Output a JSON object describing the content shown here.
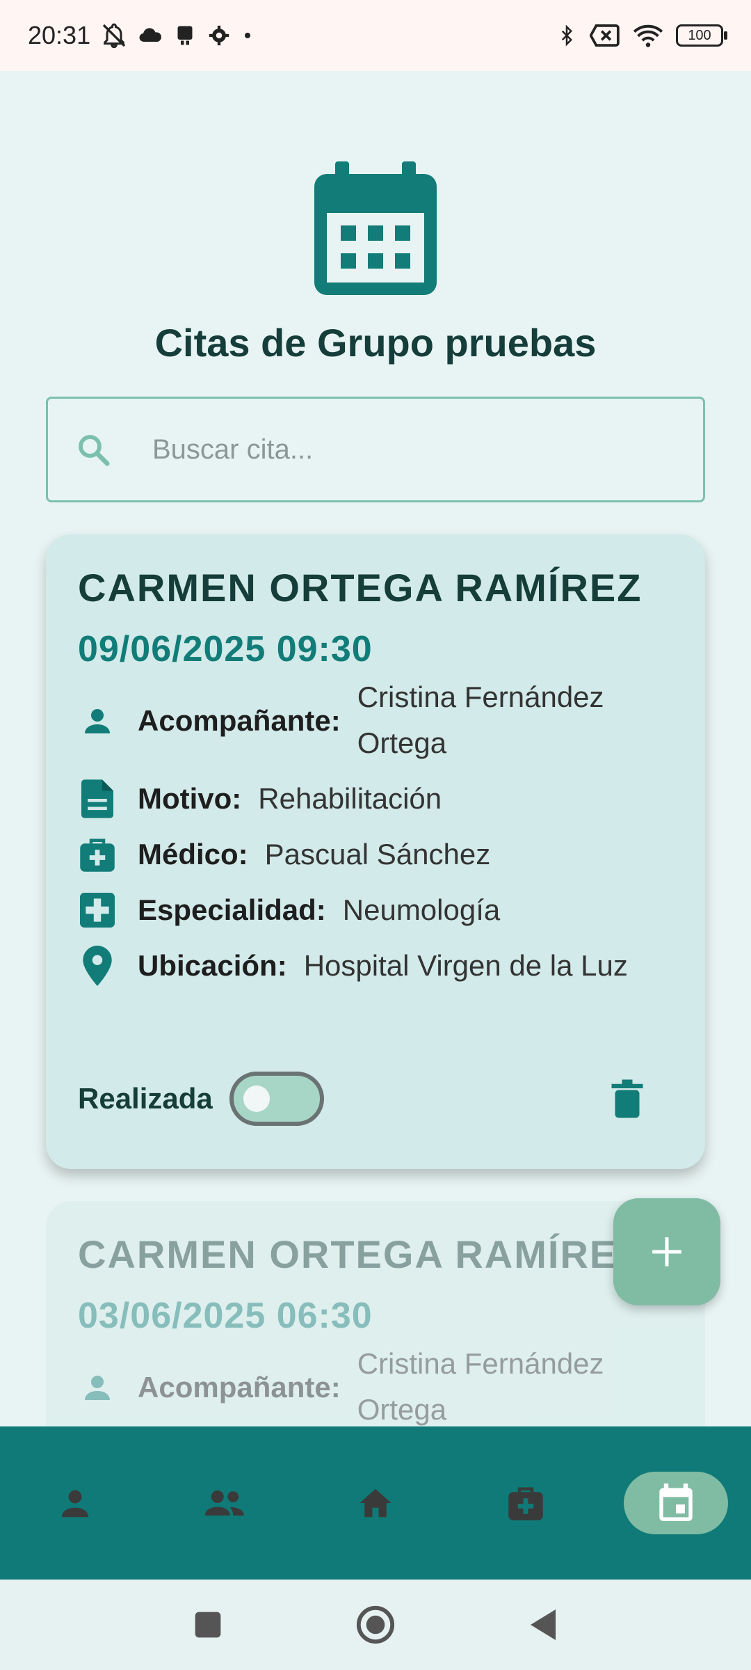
{
  "status_bar": {
    "time": "20:31",
    "battery": "100"
  },
  "page_title": "Citas de Grupo pruebas",
  "search": {
    "placeholder": "Buscar cita...",
    "value": ""
  },
  "appointments": [
    {
      "name": "CARMEN ORTEGA RAMÍREZ",
      "datetime": "09/06/2025 09:30",
      "companion_label": "Acompañante:",
      "companion": "Cristina Fernández Ortega",
      "reason_label": "Motivo:",
      "reason": "Rehabilitación",
      "doctor_label": "Médico:",
      "doctor": "Pascual Sánchez",
      "specialty_label": "Especialidad:",
      "specialty": "Neumología",
      "location_label": "Ubicación:",
      "location": "Hospital Virgen de la Luz",
      "done_label": "Realizada",
      "done": false
    },
    {
      "name": "CARMEN ORTEGA RAMÍREZ",
      "datetime": "03/06/2025 06:30",
      "companion_label": "Acompañante:",
      "companion": "Cristina Fernández Ortega"
    }
  ],
  "bottom_nav": [
    {
      "icon": "person-icon",
      "active": false
    },
    {
      "icon": "group-icon",
      "active": false
    },
    {
      "icon": "home-icon",
      "active": false
    },
    {
      "icon": "medical-bag-icon",
      "active": false
    },
    {
      "icon": "calendar-icon",
      "active": true
    }
  ],
  "colors": {
    "primary": "#0F7A77",
    "accent": "#80BBA4",
    "card": "#D2EAE9",
    "background": "#E8F4F3"
  }
}
